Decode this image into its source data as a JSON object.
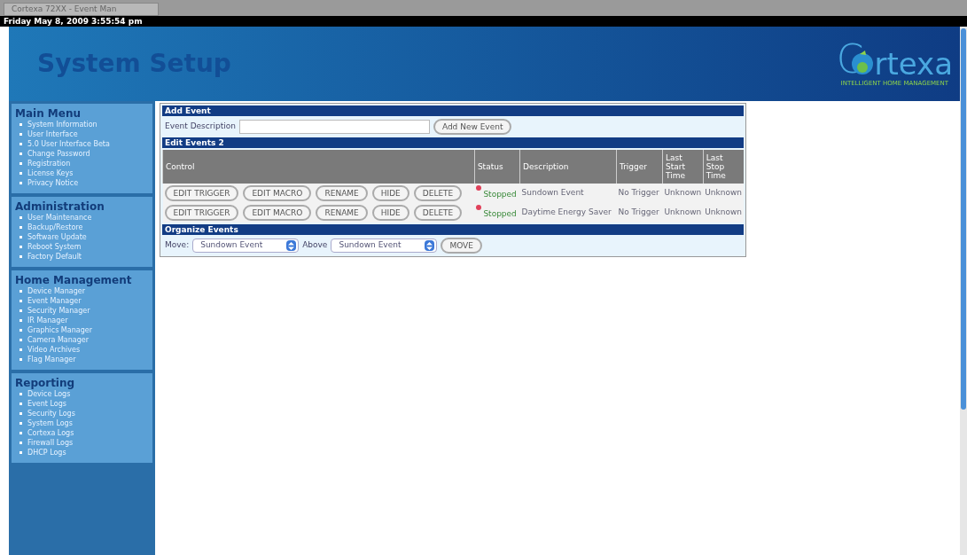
{
  "browser_tab": {
    "title": "Cortexa 72XX - Event Man"
  },
  "date_bar": "Friday May 8, 2009 3:55:54 pm",
  "header": {
    "title": "System Setup",
    "logo": {
      "lead": "C",
      "rest": "rtexa",
      "tagline": "INTELLIGENT HOME MANAGEMENT"
    }
  },
  "sidebar": [
    {
      "title": "Main Menu",
      "items": [
        "System Information",
        "User Interface",
        "5.0 User Interface Beta",
        "Change Password",
        "Registration",
        "License Keys",
        "Privacy Notice"
      ]
    },
    {
      "title": "Administration",
      "items": [
        "User Maintenance",
        "Backup/Restore",
        "Software Update",
        "Reboot System",
        "Factory Default"
      ]
    },
    {
      "title": "Home Management",
      "items": [
        "Device Manager",
        "Event Manager",
        "Security Manager",
        "IR Manager",
        "Graphics Manager",
        "Camera Manager",
        "Video Archives",
        "Flag Manager"
      ]
    },
    {
      "title": "Reporting",
      "items": [
        "Device Logs",
        "Event Logs",
        "Security Logs",
        "System Logs",
        "Cortexa Logs",
        "Firewall Logs",
        "DHCP Logs"
      ]
    }
  ],
  "add_event": {
    "title": "Add Event",
    "label": "Event Description",
    "button": "Add New Event"
  },
  "edit_events": {
    "title": "Edit Events 2",
    "columns": [
      "Control",
      "Status",
      "Description",
      "Trigger",
      "Last Start Time",
      "Last Stop Time"
    ],
    "rows": [
      {
        "buttons": [
          "EDIT TRIGGER",
          "EDIT MACRO",
          "RENAME",
          "HIDE",
          "DELETE"
        ],
        "status": "Stopped",
        "color": "#e0405a",
        "description": "Sundown Event",
        "trigger": "No Trigger",
        "last_start": "Unknown",
        "last_stop": "Unknown"
      },
      {
        "buttons": [
          "EDIT TRIGGER",
          "EDIT MACRO",
          "RENAME",
          "HIDE",
          "DELETE"
        ],
        "status": "Stopped",
        "color": "#e0405a",
        "description": "Daytime Energy Saver",
        "trigger": "No Trigger",
        "last_start": "Unknown",
        "last_stop": "Unknown"
      }
    ]
  },
  "organize": {
    "title": "Organize Events",
    "move_label": "Move:",
    "move_value": "Sundown Event",
    "above_label": "Above",
    "above_value": "Sundown Event",
    "button": "MOVE"
  }
}
